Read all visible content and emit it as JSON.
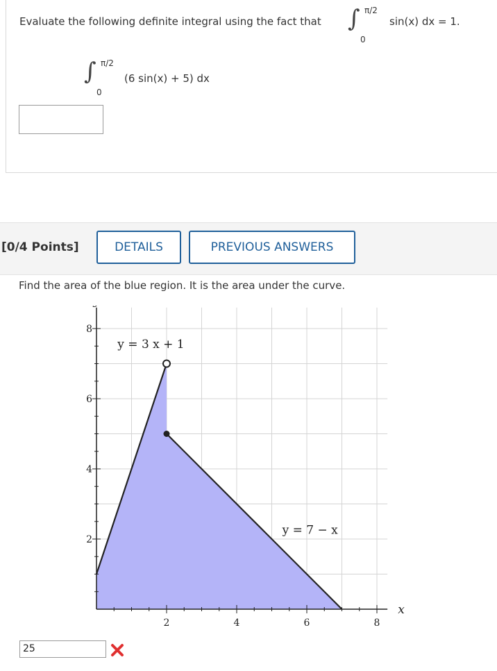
{
  "q1": {
    "prompt": "Evaluate the following definite integral using the fact that",
    "fact_upper": "π/2",
    "fact_lower": "0",
    "fact_body": "sin(x) dx = 1.",
    "integral_upper": "π/2",
    "integral_lower": "0",
    "integral_body": "(6 sin(x) + 5) dx",
    "answer_value": ""
  },
  "q2": {
    "points": "[0/4 Points]",
    "details_label": "DETAILS",
    "previous_answers_label": "PREVIOUS ANSWERS",
    "prompt": "Find the area of the blue region. It is the area under the curve.",
    "response_value": "25",
    "incorrect_icon": "x-mark-icon",
    "incorrect_color": "#e03030"
  },
  "chart_data": {
    "type": "area",
    "xlabel": "x",
    "ylabel": "y",
    "xlim": [
      0,
      8
    ],
    "ylim": [
      0,
      8
    ],
    "x_ticks": [
      2,
      4,
      6,
      8
    ],
    "y_ticks": [
      2,
      4,
      6,
      8
    ],
    "grid": true,
    "fill_color": "#b4b4f8",
    "line_color": "#222222",
    "series": [
      {
        "name": "y = 3 x + 1",
        "x": [
          0,
          2
        ],
        "y": [
          1,
          7
        ]
      },
      {
        "name": "y = 7 − x",
        "x": [
          2,
          7
        ],
        "y": [
          5,
          0
        ]
      }
    ],
    "open_point": {
      "x": 2,
      "y": 7
    },
    "closed_point": {
      "x": 2,
      "y": 5
    },
    "labels": {
      "left_curve": "y = 3 x + 1",
      "right_curve": "y = 7 − x"
    }
  }
}
